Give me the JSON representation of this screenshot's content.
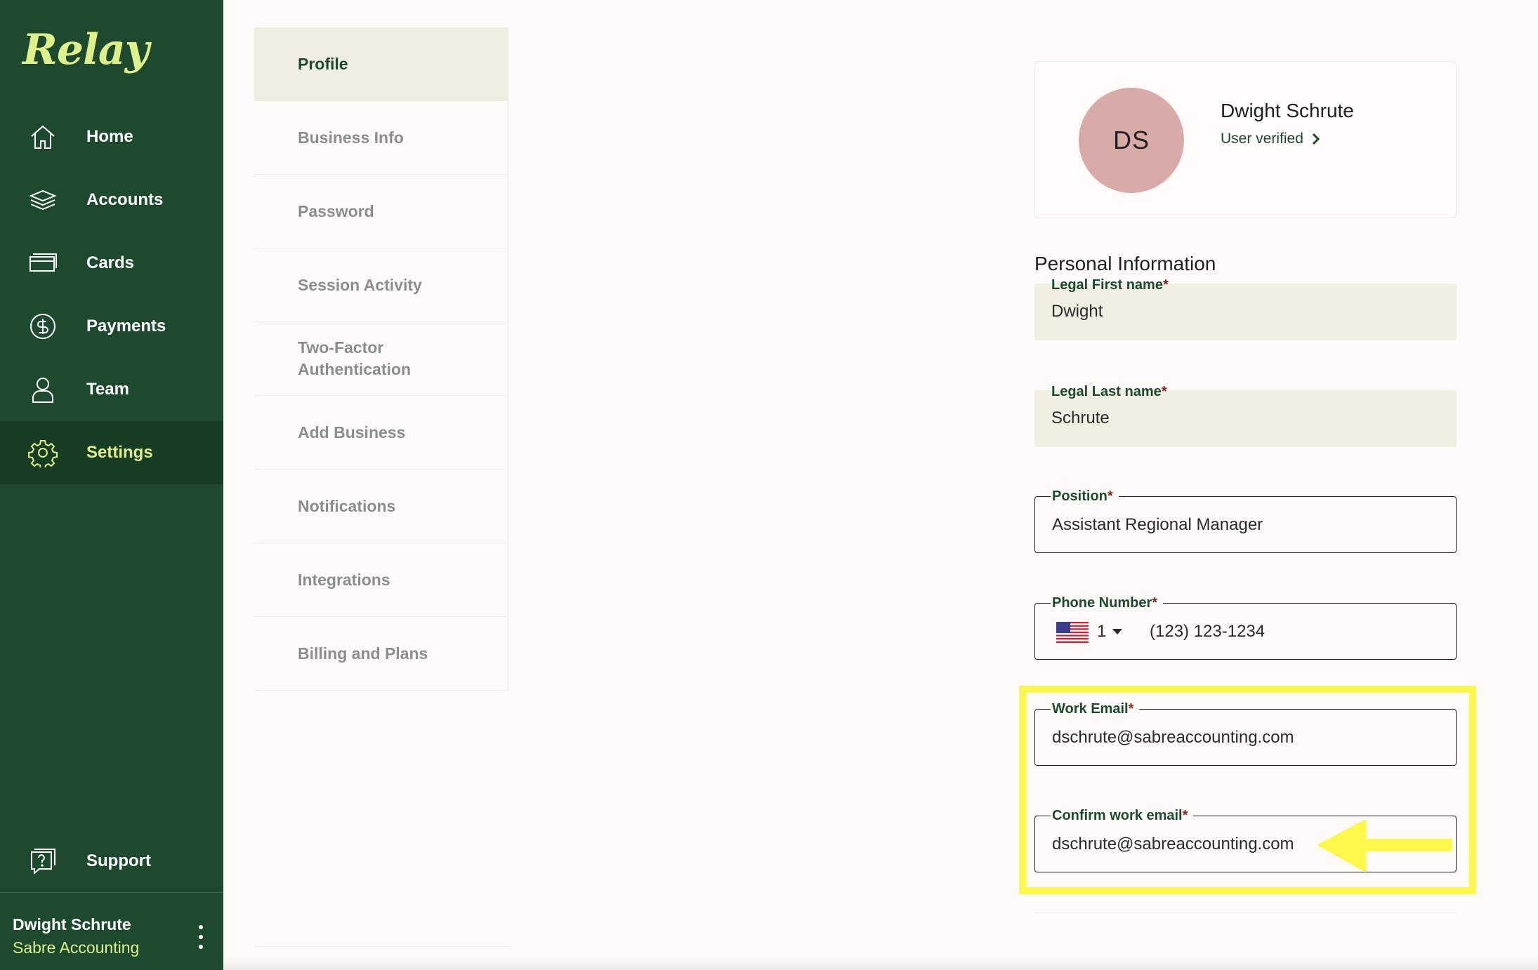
{
  "brand": {
    "logo": "Relay"
  },
  "sidebar": {
    "items": [
      {
        "label": "Home",
        "icon": "home-icon",
        "active": false
      },
      {
        "label": "Accounts",
        "icon": "layers-icon",
        "active": false
      },
      {
        "label": "Cards",
        "icon": "card-icon",
        "active": false
      },
      {
        "label": "Payments",
        "icon": "dollar-circle-icon",
        "active": false
      },
      {
        "label": "Team",
        "icon": "person-icon",
        "active": false
      },
      {
        "label": "Settings",
        "icon": "gear-icon",
        "active": true
      }
    ],
    "support": {
      "label": "Support",
      "icon": "help-chat-icon"
    },
    "user": {
      "name": "Dwight Schrute",
      "org": "Sabre Accounting"
    }
  },
  "settings_menu": {
    "items": [
      {
        "label": "Profile",
        "active": true
      },
      {
        "label": "Business Info",
        "active": false
      },
      {
        "label": "Password",
        "active": false
      },
      {
        "label": "Session Activity",
        "active": false
      },
      {
        "label": "Two-Factor Authentication",
        "active": false
      },
      {
        "label": "Add Business",
        "active": false
      },
      {
        "label": "Notifications",
        "active": false
      },
      {
        "label": "Integrations",
        "active": false
      },
      {
        "label": "Billing and Plans",
        "active": false
      }
    ]
  },
  "profile": {
    "initials": "DS",
    "name": "Dwight Schrute",
    "verified_label": "User verified"
  },
  "personal_info": {
    "title": "Personal Information",
    "first_name": {
      "label": "Legal First name",
      "value": "Dwight"
    },
    "last_name": {
      "label": "Legal Last name",
      "value": "Schrute"
    },
    "position": {
      "label": "Position",
      "value": "Assistant Regional Manager"
    },
    "phone": {
      "label": "Phone Number",
      "country_code": "1",
      "value": "(123) 123-1234"
    },
    "work_email": {
      "label": "Work Email",
      "value": "dschrute@sabreaccounting.com"
    },
    "confirm_email": {
      "label": "Confirm work email",
      "value": "dschrute@sabreaccounting.com"
    },
    "required_mark": "*"
  },
  "colors": {
    "sidebar_bg": "#1d4a2e",
    "accent": "#dff08a",
    "highlight": "#fcf84a",
    "avatar_bg": "#d9aba8"
  }
}
